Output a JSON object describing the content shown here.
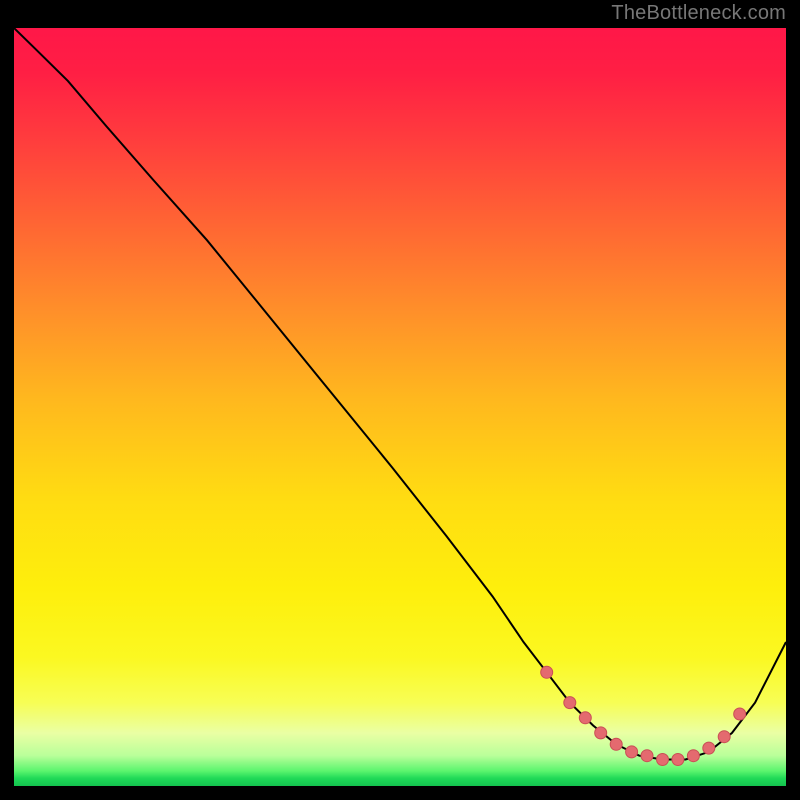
{
  "watermark": "TheBottleneck.com",
  "colors": {
    "curve_stroke": "#000000",
    "marker_fill": "#e46a6f",
    "marker_stroke": "#c94f55"
  },
  "chart_data": {
    "type": "line",
    "title": "",
    "xlabel": "",
    "ylabel": "",
    "xlim": [
      0,
      100
    ],
    "ylim": [
      0,
      100
    ],
    "grid": false,
    "legend": false,
    "series": [
      {
        "name": "curve",
        "x": [
          0,
          3,
          7,
          12,
          18,
          25,
          33,
          41,
          49,
          56,
          62,
          66,
          69,
          72,
          75,
          78,
          81,
          84,
          87,
          90,
          93,
          96,
          100
        ],
        "y": [
          100,
          97,
          93,
          87,
          80,
          72,
          62,
          52,
          42,
          33,
          25,
          19,
          15,
          11,
          8,
          5.5,
          4,
          3.5,
          3.5,
          4.5,
          7,
          11,
          19
        ]
      }
    ],
    "markers": {
      "x": [
        69,
        72,
        74,
        76,
        78,
        80,
        82,
        84,
        86,
        88,
        90,
        92,
        94
      ],
      "y": [
        15,
        11,
        9,
        7,
        5.5,
        4.5,
        4,
        3.5,
        3.5,
        4,
        5,
        6.5,
        9.5
      ]
    }
  }
}
